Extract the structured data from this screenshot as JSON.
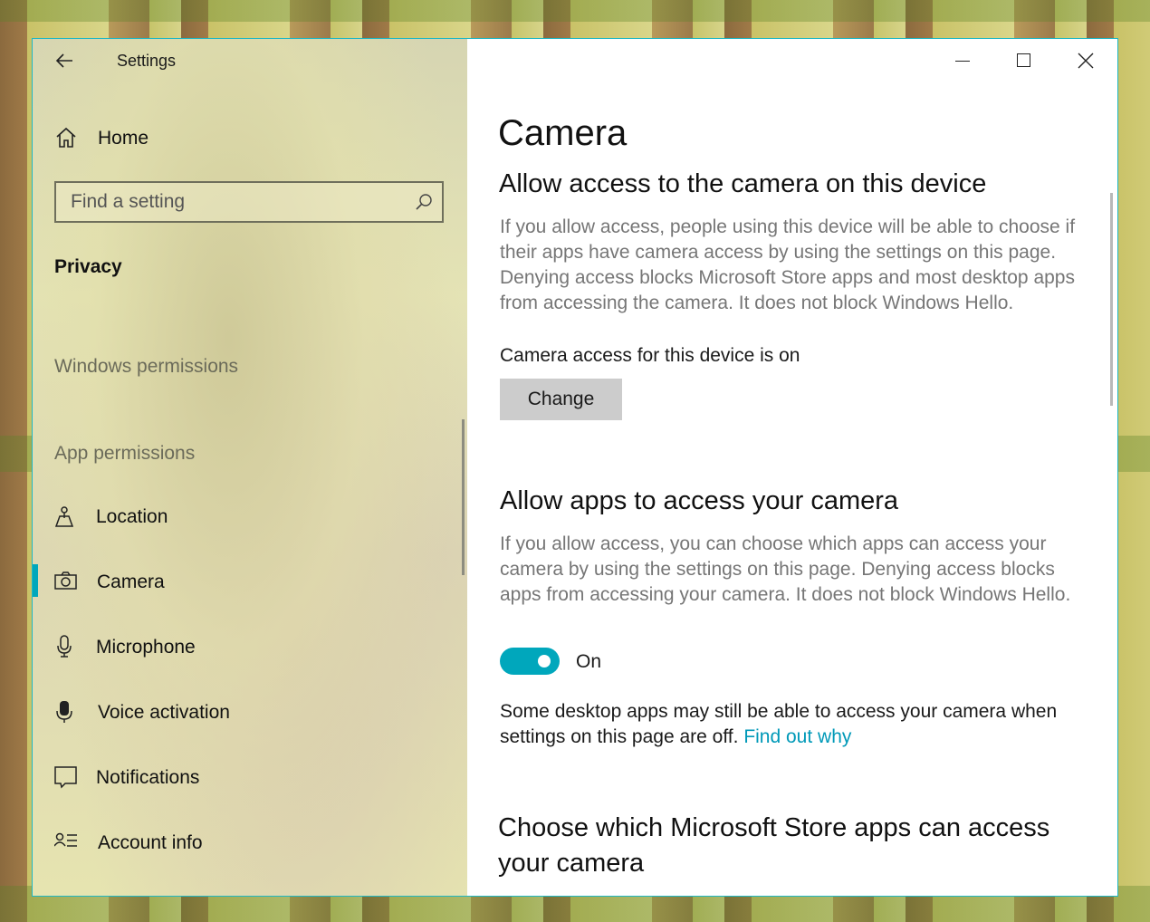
{
  "window": {
    "title": "Settings",
    "controls": {
      "minimize": "minimize-icon",
      "maximize": "maximize-icon",
      "close": "close-icon"
    }
  },
  "sidebar": {
    "home_label": "Home",
    "search_placeholder": "Find a setting",
    "category": "Privacy",
    "section_windows": "Windows permissions",
    "section_app": "App permissions",
    "items": [
      {
        "label": "Location",
        "icon": "location-icon"
      },
      {
        "label": "Camera",
        "icon": "camera-icon",
        "selected": true
      },
      {
        "label": "Microphone",
        "icon": "microphone-icon"
      },
      {
        "label": "Voice activation",
        "icon": "voice-activation-icon"
      },
      {
        "label": "Notifications",
        "icon": "notifications-icon"
      },
      {
        "label": "Account info",
        "icon": "account-info-icon"
      }
    ]
  },
  "main": {
    "page_title": "Camera",
    "device_section": {
      "heading": "Allow access to the camera on this device",
      "description": "If you allow access, people using this device will be able to choose if their apps have camera access by using the settings on this page. Denying access blocks Microsoft Store apps and most desktop apps from accessing the camera. It does not block Windows Hello.",
      "status": "Camera access for this device is on",
      "button": "Change"
    },
    "apps_section": {
      "heading": "Allow apps to access your camera",
      "description": "If you allow access, you can choose which apps can access your camera by using the settings on this page. Denying access blocks apps from accessing your camera. It does not block Windows Hello.",
      "toggle_label": "On",
      "toggle_on": true,
      "note": "Some desktop apps may still be able to access your camera when settings on this page are off.",
      "link": "Find out why"
    },
    "store_section": {
      "heading": "Choose which Microsoft Store apps can access your camera"
    }
  },
  "colors": {
    "accent": "#00a7bc",
    "link": "#0099b8",
    "window_border": "#1fb7c4"
  }
}
